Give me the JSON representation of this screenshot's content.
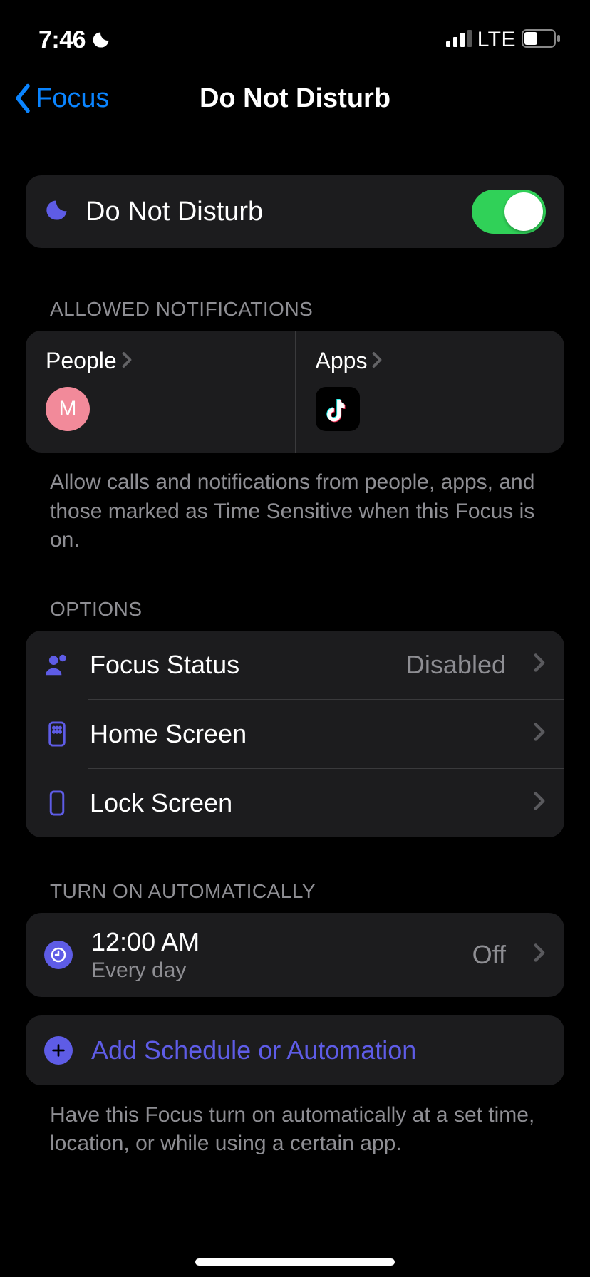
{
  "status": {
    "time": "7:46",
    "network": "LTE"
  },
  "nav": {
    "back_label": "Focus",
    "title": "Do Not Disturb"
  },
  "main_toggle": {
    "label": "Do Not Disturb",
    "enabled": true
  },
  "allowed": {
    "header": "ALLOWED NOTIFICATIONS",
    "people_label": "People",
    "people_avatar_initial": "M",
    "apps_label": "Apps",
    "footer": "Allow calls and notifications from people, apps, and those marked as Time Sensitive when this Focus is on."
  },
  "options": {
    "header": "OPTIONS",
    "focus_status": {
      "label": "Focus Status",
      "value": "Disabled"
    },
    "home_screen": {
      "label": "Home Screen"
    },
    "lock_screen": {
      "label": "Lock Screen"
    }
  },
  "automation": {
    "header": "TURN ON AUTOMATICALLY",
    "schedule": {
      "time": "12:00 AM",
      "repeat": "Every day",
      "state": "Off"
    },
    "add_label": "Add Schedule or Automation",
    "footer": "Have this Focus turn on automatically at a set time, location, or while using a certain app."
  }
}
